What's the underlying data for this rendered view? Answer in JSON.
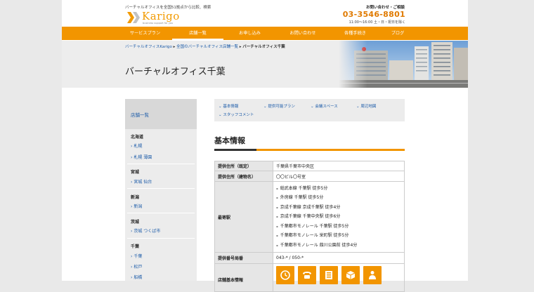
{
  "header": {
    "tagline": "バーチャルオフィスを全国51拠点から比較、検索",
    "logo_text": "Karigo",
    "logo_sub": "business support for you",
    "contact_label": "お問い合わせ・ご相談",
    "phone": "03-3546-8801",
    "hours": "11:00〜16:00 土・日・祝日を除く"
  },
  "nav": {
    "items": [
      {
        "label": "サービスプラン"
      },
      {
        "label": "店舗一覧"
      },
      {
        "label": "お申し込み"
      },
      {
        "label": "お問い合わせ"
      },
      {
        "label": "各種手続き"
      },
      {
        "label": "ブログ"
      }
    ]
  },
  "breadcrumb": {
    "home": "バーチャルオフィスKarigo",
    "list": "全国のバーチャルオフィス店舗一覧",
    "current": "バーチャルオフィス千葉"
  },
  "hero": {
    "title": "バーチャルオフィス千葉"
  },
  "sidebar": {
    "header": "店舗一覧",
    "groups": [
      {
        "name": "北海道",
        "links": [
          "札幌",
          "札幌 薄園"
        ]
      },
      {
        "name": "宮城",
        "links": [
          "宮城 仙台"
        ]
      },
      {
        "name": "新潟",
        "links": [
          "新潟"
        ]
      },
      {
        "name": "茨城",
        "links": [
          "茨城 つくば市"
        ]
      },
      {
        "name": "千葉",
        "links": [
          "千葉",
          "松戸",
          "船橋"
        ]
      }
    ]
  },
  "anchors": [
    "基本情報",
    "提供可能プラン",
    "会議スペース",
    "周辺地図",
    "スタッフコメント"
  ],
  "section": {
    "title": "基本情報"
  },
  "table": {
    "address_label": "提供住所（既定）",
    "address": "千葉県千葉市中央区",
    "building_label": "提供住所（建物名）",
    "building": "〇〇ビル〇号室",
    "station_label": "最寄駅",
    "stations": [
      "総武本線 千葉駅 徒歩5分",
      "外房線 千葉駅 徒歩5分",
      "京成千葉線 京成千葉駅 徒歩4分",
      "京成千葉線 千葉中央駅 徒歩6分",
      "千葉都市モノレール 千葉駅 徒歩5分",
      "千葉都市モノレール 栄町駅 徒歩5分",
      "千葉都市モノレール 葭川公園前 徒歩4分"
    ],
    "phone_label": "提供番号局番",
    "phone": "043-* / 050-*",
    "services_label": "店舗基本情報",
    "service_icons": [
      {
        "icon": "clock-icon",
        "label": "受付時間"
      },
      {
        "icon": "telephone-icon",
        "label": "電話転送"
      },
      {
        "icon": "fax-icon",
        "label": "FAX"
      },
      {
        "icon": "package-icon",
        "label": "郵便物"
      },
      {
        "icon": "person-icon",
        "label": "会議室"
      }
    ]
  },
  "colors": {
    "accent": "#f29500",
    "link": "#1a5aa8",
    "phone": "#e07a00"
  }
}
